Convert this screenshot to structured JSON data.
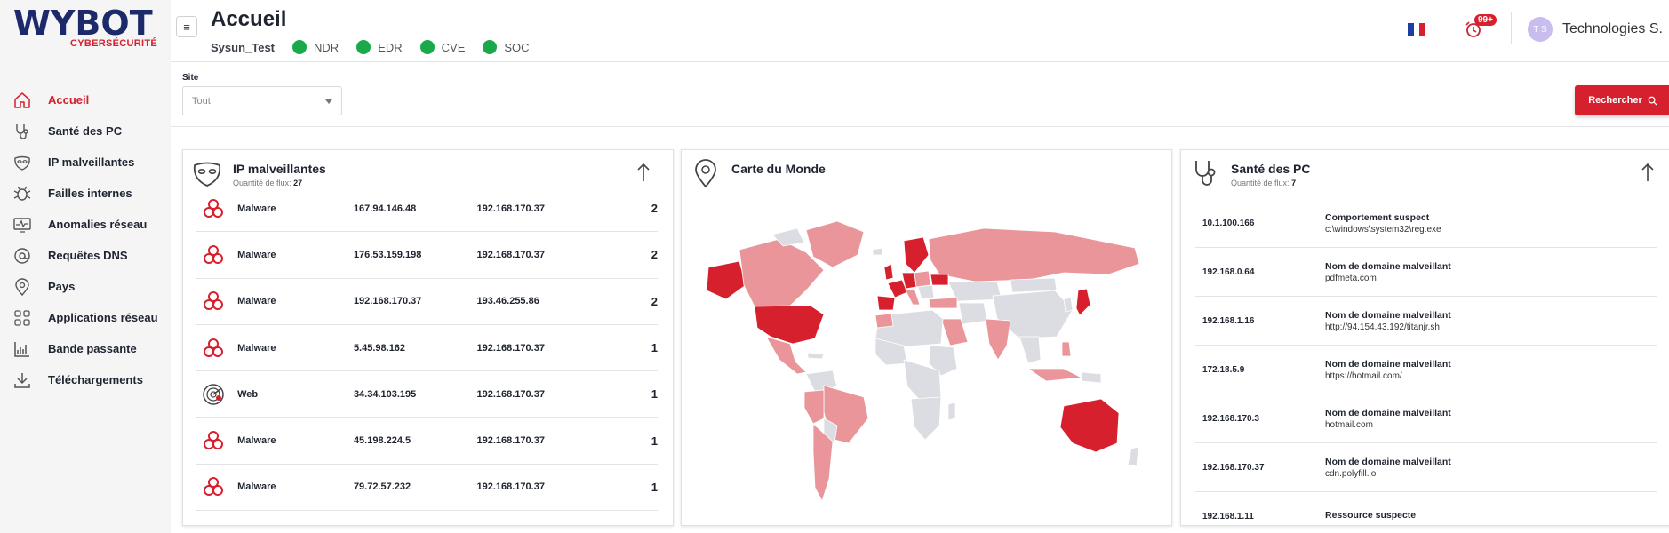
{
  "logo": {
    "main": "WYBOT",
    "sub": "CYBERSÉCURITÉ"
  },
  "sidebar": {
    "items": [
      {
        "label": "Accueil",
        "icon": "home-icon",
        "active": true
      },
      {
        "label": "Santé des PC",
        "icon": "stethoscope-icon"
      },
      {
        "label": "IP malveillantes",
        "icon": "mask-icon"
      },
      {
        "label": "Failles internes",
        "icon": "bug-icon"
      },
      {
        "label": "Anomalies réseau",
        "icon": "monitor-pulse-icon"
      },
      {
        "label": "Requêtes DNS",
        "icon": "at-sign-icon"
      },
      {
        "label": "Pays",
        "icon": "map-pin-icon"
      },
      {
        "label": "Applications réseau",
        "icon": "apps-grid-icon"
      },
      {
        "label": "Bande passante",
        "icon": "bar-chart-icon"
      },
      {
        "label": "Téléchargements",
        "icon": "download-icon"
      }
    ]
  },
  "header": {
    "menu_icon": "≡",
    "title": "Accueil",
    "org": "Sysun_Test",
    "statuses": [
      {
        "label": "NDR",
        "color": "#1aa94a"
      },
      {
        "label": "EDR",
        "color": "#1aa94a"
      },
      {
        "label": "CVE",
        "color": "#1aa94a"
      },
      {
        "label": "SOC",
        "color": "#1aa94a"
      }
    ],
    "notifications_badge": "99+",
    "avatar_initials": "T S",
    "user_name": "Technologies S."
  },
  "filters": {
    "site_label": "Site",
    "site_value": "Tout",
    "search_label": "Rechercher"
  },
  "ip_card": {
    "title": "IP malveillantes",
    "subtitle_label": "Quantité de flux:",
    "subtitle_value": "27",
    "rows": [
      {
        "type": "Malware",
        "icon": "biohazard-icon",
        "src": "167.94.146.48",
        "dst": "192.168.170.37",
        "count": "2"
      },
      {
        "type": "Malware",
        "icon": "biohazard-icon",
        "src": "176.53.159.198",
        "dst": "192.168.170.37",
        "count": "2"
      },
      {
        "type": "Malware",
        "icon": "biohazard-icon",
        "src": "192.168.170.37",
        "dst": "193.46.255.86",
        "count": "2"
      },
      {
        "type": "Malware",
        "icon": "biohazard-icon",
        "src": "5.45.98.162",
        "dst": "192.168.170.37",
        "count": "1"
      },
      {
        "type": "Web",
        "icon": "radar-icon",
        "src": "34.34.103.195",
        "dst": "192.168.170.37",
        "count": "1"
      },
      {
        "type": "Malware",
        "icon": "biohazard-icon",
        "src": "45.198.224.5",
        "dst": "192.168.170.37",
        "count": "1"
      },
      {
        "type": "Malware",
        "icon": "biohazard-icon",
        "src": "79.72.57.232",
        "dst": "192.168.170.37",
        "count": "1"
      }
    ]
  },
  "map_card": {
    "title": "Carte du Monde",
    "colors": {
      "high": "#d6202e",
      "medium": "#e9959a",
      "none": "#dcdde2"
    }
  },
  "pc_card": {
    "title": "Santé des PC",
    "subtitle_label": "Quantité de flux:",
    "subtitle_value": "7",
    "rows": [
      {
        "ip": "10.1.100.166",
        "title": "Comportement suspect",
        "value": "c:\\windows\\system32\\reg.exe"
      },
      {
        "ip": "192.168.0.64",
        "title": "Nom de domaine malveillant",
        "value": "pdfmeta.com"
      },
      {
        "ip": "192.168.1.16",
        "title": "Nom de domaine malveillant",
        "value": "http://94.154.43.192/titanjr.sh"
      },
      {
        "ip": "172.18.5.9",
        "title": "Nom de domaine malveillant",
        "value": "https://hotmail.com/"
      },
      {
        "ip": "192.168.170.3",
        "title": "Nom de domaine malveillant",
        "value": "hotmail.com"
      },
      {
        "ip": "192.168.170.37",
        "title": "Nom de domaine malveillant",
        "value": "cdn.polyfill.io"
      },
      {
        "ip": "192.168.1.11",
        "title": "Ressource suspecte",
        "value": ""
      }
    ]
  },
  "colors": {
    "accent": "#d6202e",
    "brand": "#1c2a6b",
    "ok": "#1aa94a"
  }
}
